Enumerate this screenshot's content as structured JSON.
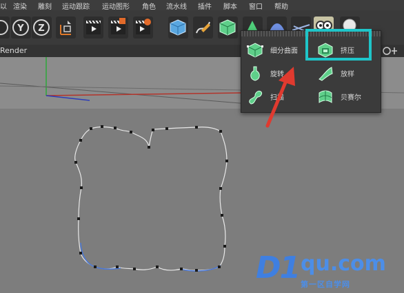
{
  "menu": {
    "items": [
      "以",
      "渲染",
      "雕刻",
      "运动跟踪",
      "运动图形",
      "角色",
      "流水线",
      "插件",
      "脚本",
      "窗口",
      "帮助"
    ]
  },
  "toolbar": {
    "buttons": [
      "x-axis-icon",
      "y-axis-icon",
      "z-axis-icon",
      "coordinate-system-icon",
      "render-view-icon",
      "render-picture-viewer-icon",
      "render-settings-icon",
      "cube-icon",
      "pen-icon",
      "subdivision-surface-icon",
      "generator-icon",
      "deformer-icon",
      "floor-icon",
      "camera-icon",
      "light-icon"
    ]
  },
  "viewport": {
    "header_label": "Render"
  },
  "popup": {
    "items": [
      {
        "label": "细分曲面",
        "icon": "subdivision-surface-icon"
      },
      {
        "label": "挤压",
        "icon": "extrude-icon"
      },
      {
        "label": "旋转",
        "icon": "lathe-icon"
      },
      {
        "label": "放样",
        "icon": "loft-icon"
      },
      {
        "label": "扫描",
        "icon": "sweep-icon"
      },
      {
        "label": "贝赛尔",
        "icon": "bezier-icon"
      }
    ]
  },
  "watermark": {
    "brand": "D1",
    "domain": "qu.com",
    "tagline": "第一区自学网"
  },
  "colors": {
    "highlight": "#1ec5c9",
    "arrow": "#e03a2f",
    "spline": "#e8e8e8",
    "watermark": "#3f7fe0"
  }
}
